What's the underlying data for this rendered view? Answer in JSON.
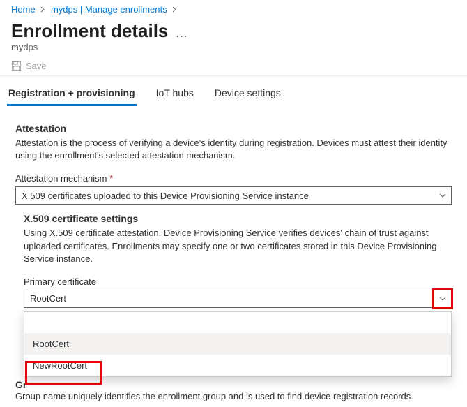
{
  "breadcrumb": {
    "home": "Home",
    "mid": "mydps | Manage enrollments"
  },
  "page": {
    "title": "Enrollment details",
    "subtitle": "mydps"
  },
  "toolbar": {
    "save_label": "Save"
  },
  "tabs": {
    "t0": "Registration + provisioning",
    "t1": "IoT hubs",
    "t2": "Device settings"
  },
  "attestation": {
    "heading": "Attestation",
    "desc": "Attestation is the process of verifying a device's identity during registration. Devices must attest their identity using the enrollment's selected attestation mechanism.",
    "mech_label": "Attestation mechanism",
    "mech_value": "X.509 certificates uploaded to this Device Provisioning Service instance"
  },
  "x509": {
    "heading": "X.509 certificate settings",
    "desc": "Using X.509 certificate attestation, Device Provisioning Service verifies devices' chain of trust against uploaded certificates. Enrollments may specify one or two certificates stored in this Device Provisioning Service instance.",
    "primary_label": "Primary certificate",
    "primary_value": "RootCert",
    "options": {
      "opt0": "RootCert",
      "opt1": "NewRootCert"
    }
  },
  "group": {
    "heading_partial": "Gr",
    "desc": "Group name uniquely identifies the enrollment group and is used to find device registration records."
  }
}
